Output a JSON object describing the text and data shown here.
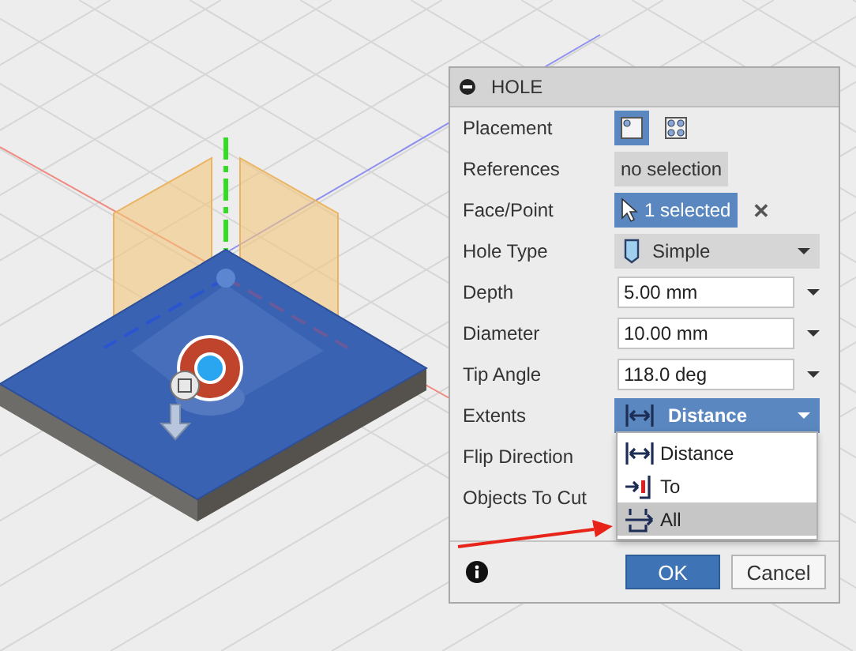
{
  "dialog": {
    "title": "HOLE",
    "rows": [
      {
        "kind": "icons",
        "label": "Placement",
        "options": [
          {
            "selected": true
          },
          {
            "selected": false
          }
        ]
      },
      {
        "kind": "chip",
        "label": "References",
        "value": "no selection",
        "active": false
      },
      {
        "kind": "chip",
        "label": "Face/Point",
        "value": "1 selected",
        "active": true,
        "clear": "✕"
      },
      {
        "kind": "dropdown",
        "label": "Hole Type",
        "value": "Simple",
        "open": false
      },
      {
        "kind": "input",
        "label": "Depth",
        "value": "5.00 mm"
      },
      {
        "kind": "input",
        "label": "Diameter",
        "value": "10.00 mm"
      },
      {
        "kind": "input",
        "label": "Tip Angle",
        "value": "118.0 deg"
      },
      {
        "kind": "dropdown",
        "label": "Extents",
        "value": "Distance",
        "open": true
      },
      {
        "kind": "empty",
        "label": "Flip Direction"
      },
      {
        "kind": "empty",
        "label": "Objects To Cut"
      }
    ],
    "menu": [
      {
        "kind": "distance",
        "label": "Distance",
        "selected": false
      },
      {
        "kind": "to",
        "label": "To",
        "selected": false
      },
      {
        "kind": "all",
        "label": "All",
        "selected": true
      }
    ],
    "buttons": [
      {
        "label": "OK",
        "primary": true
      },
      {
        "label": "Cancel",
        "primary": false
      }
    ]
  }
}
